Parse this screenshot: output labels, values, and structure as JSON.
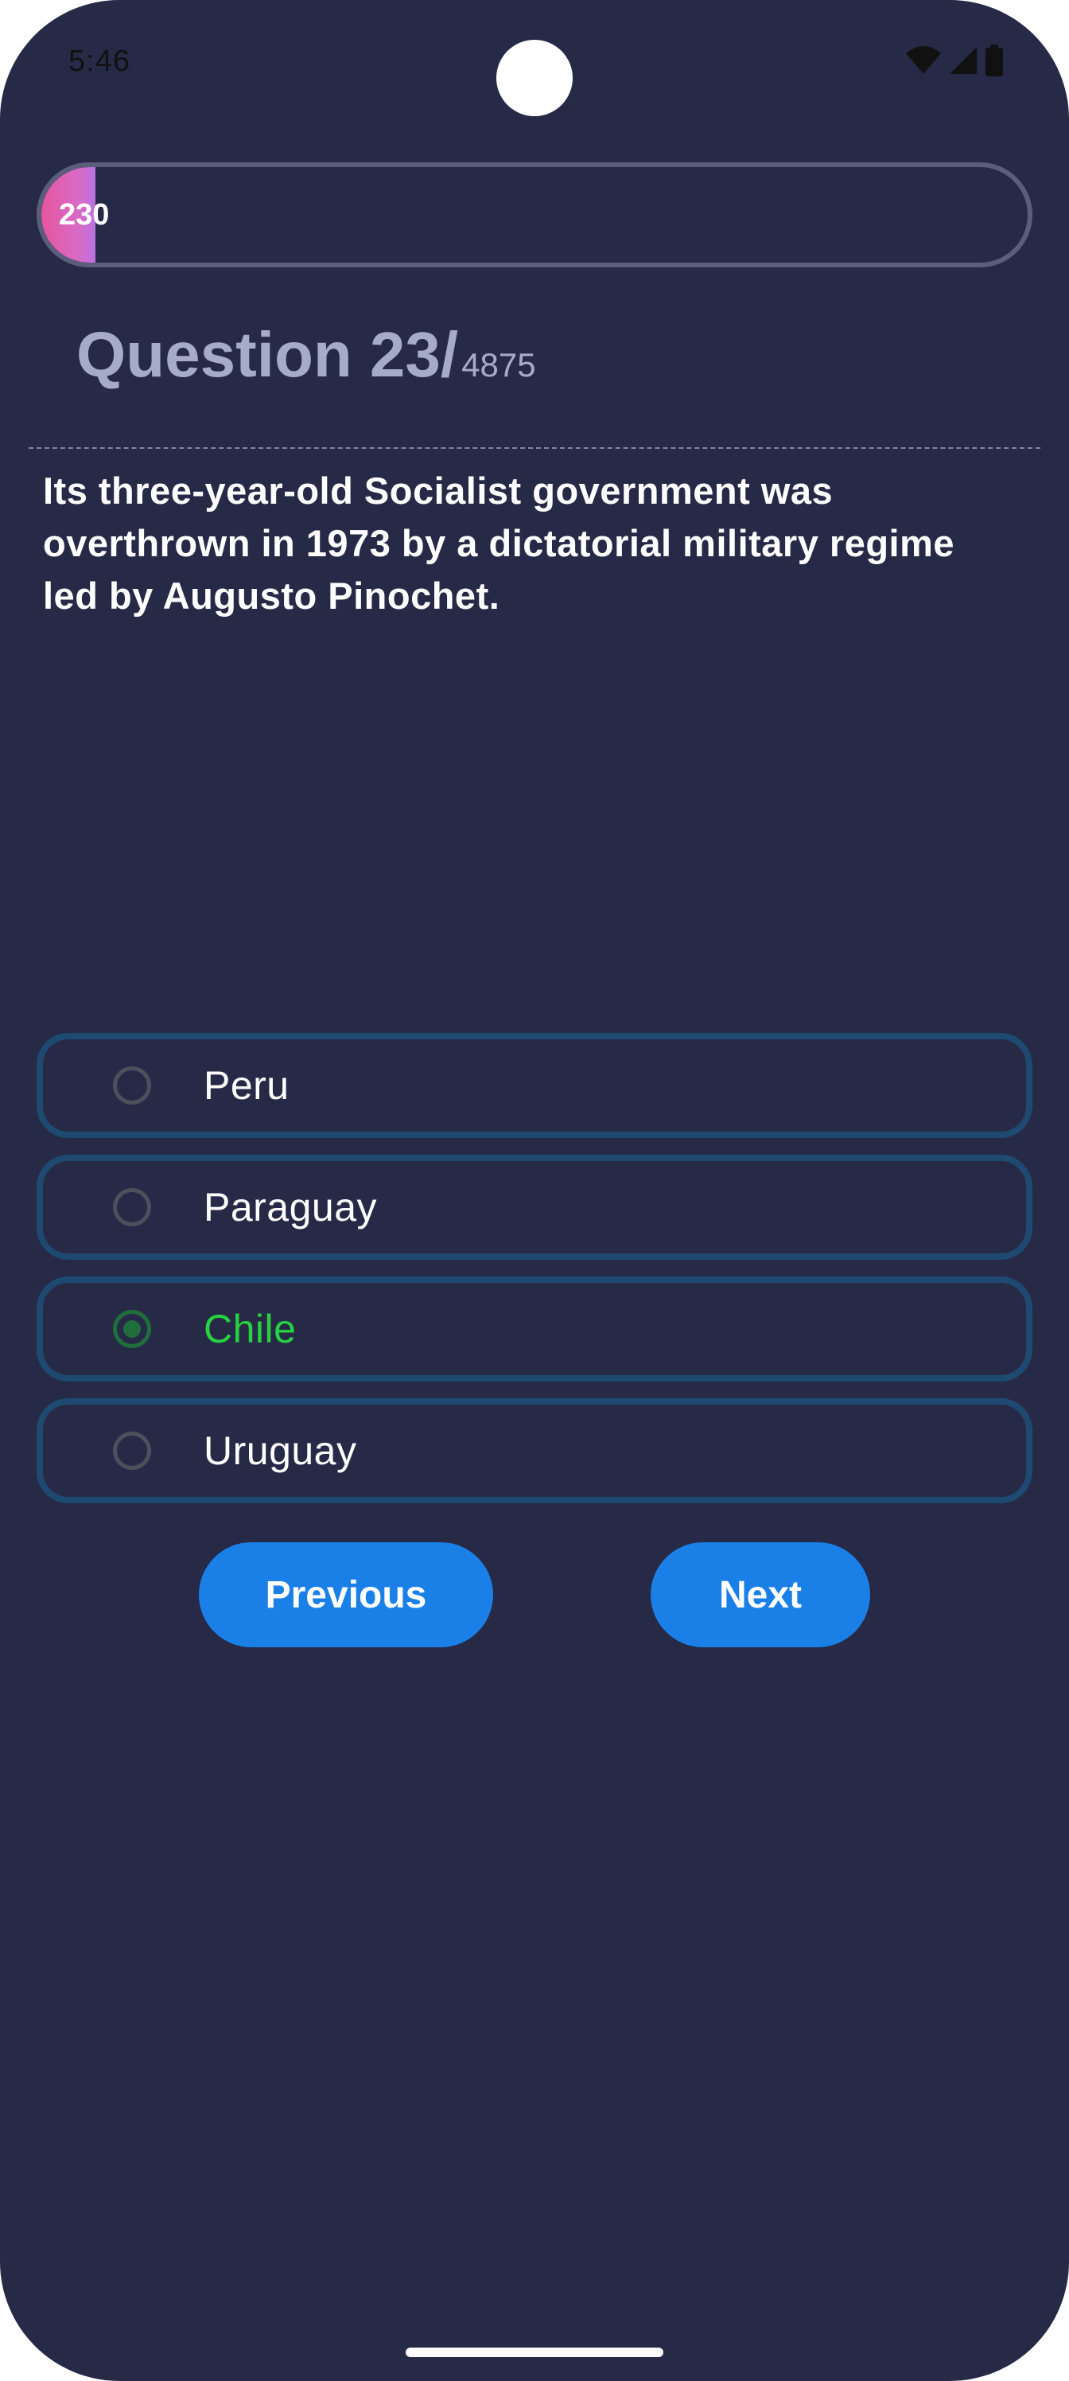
{
  "status_bar": {
    "time": "5:46",
    "icons": [
      "wifi-icon",
      "cellular-signal-icon",
      "battery-icon"
    ]
  },
  "progress": {
    "label": "230",
    "fill_fraction": 0.055,
    "gradient_colors": [
      "#e6559e",
      "#b872de"
    ]
  },
  "question": {
    "title": "Question 23/",
    "total": "4875",
    "text": "Its three-year-old Socialist government was overthrown in 1973 by a dictatorial military regime led by Augusto Pinochet."
  },
  "options": [
    {
      "label": "Peru",
      "selected": false
    },
    {
      "label": "Paraguay",
      "selected": false
    },
    {
      "label": "Chile",
      "selected": true
    },
    {
      "label": "Uruguay",
      "selected": false
    }
  ],
  "buttons": {
    "previous": "Previous",
    "next": "Next"
  },
  "colors": {
    "background": "#262a47",
    "option_border": "#1e4a72",
    "correct_text": "#27d13f",
    "button": "#1a80e8",
    "heading": "#a7abca"
  }
}
